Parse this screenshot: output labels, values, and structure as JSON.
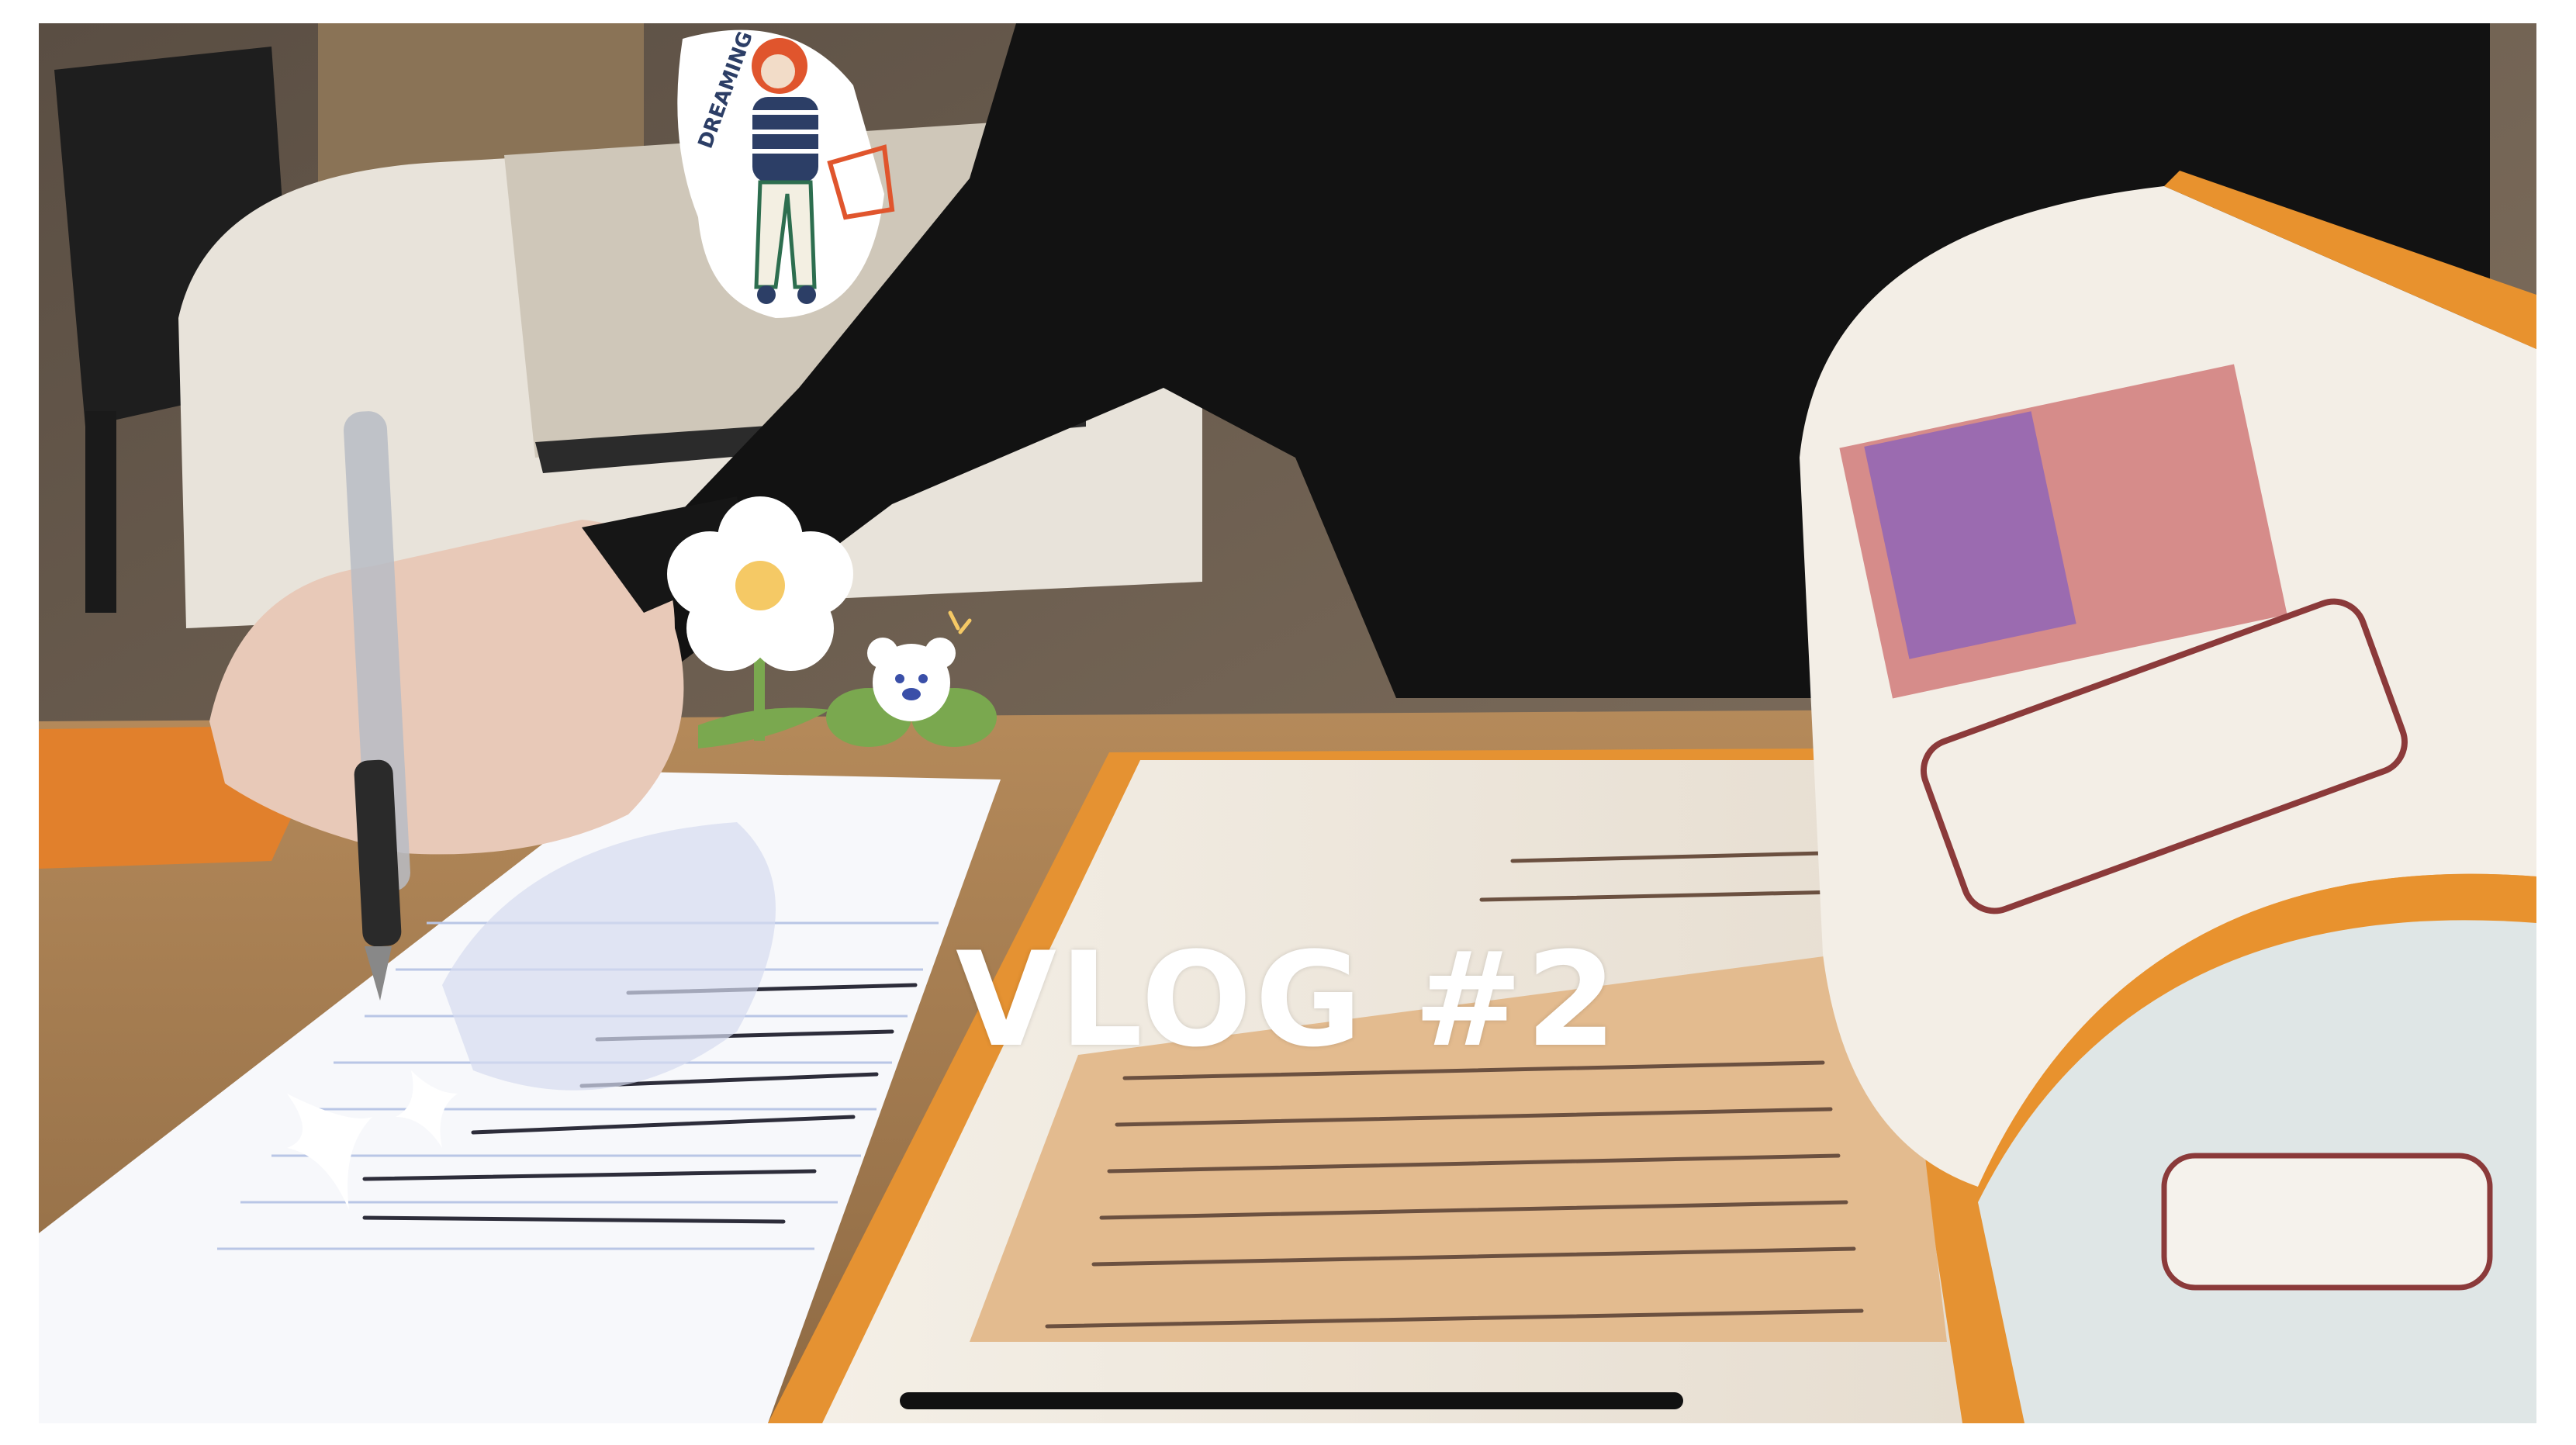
{
  "video": {
    "title": "VLOG #2"
  },
  "stickers": {
    "dreaming_text": "DREAMING"
  },
  "colors": {
    "accent_orange": "#E8962E",
    "title_white": "#FFFFFF",
    "home_indicator": "#111111"
  },
  "icons": [
    "dreaming-girl-sticker",
    "flower-sticker",
    "bear-sticker",
    "sparkle-sticker"
  ]
}
